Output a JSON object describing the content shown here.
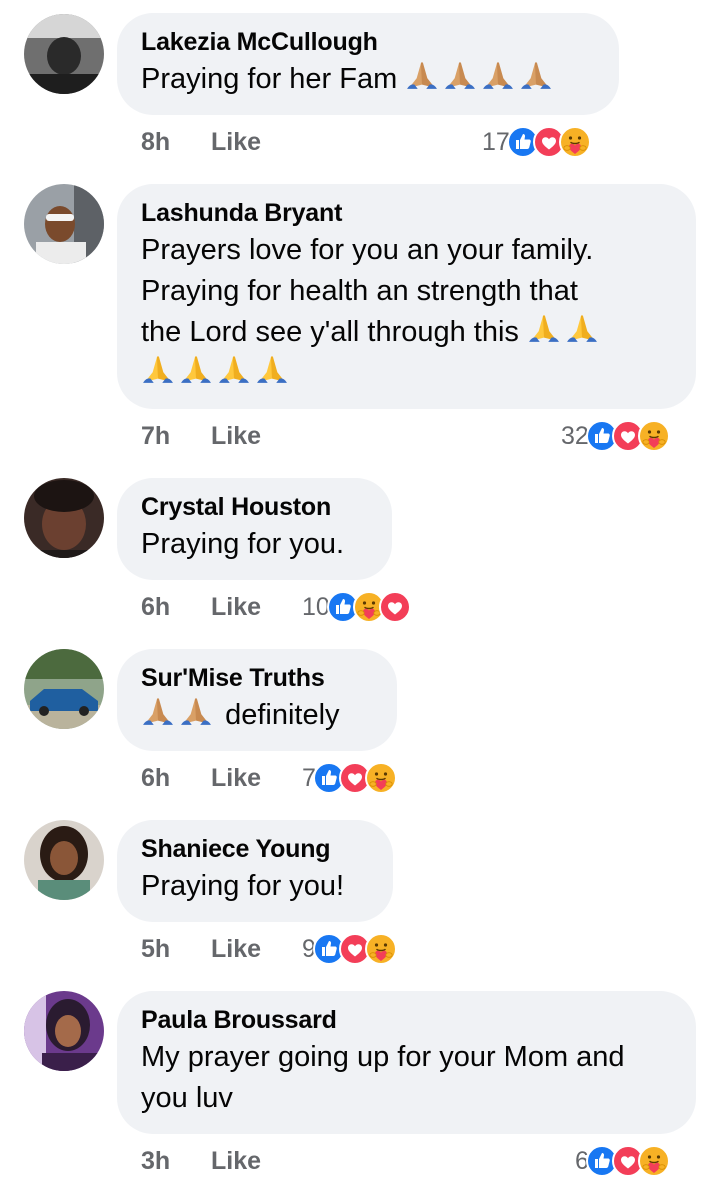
{
  "comments": [
    {
      "author": "Lakezia McCullough",
      "text": "Praying for her Fam",
      "time": "8h",
      "like": "Like",
      "count": "17"
    },
    {
      "author": "Lashunda Bryant",
      "line1": "Prayers love for you an your family.",
      "line2": "Praying for health an strength that",
      "line3": "the Lord see y'all through this",
      "time": "7h",
      "like": "Like",
      "count": "32"
    },
    {
      "author": "Crystal Houston",
      "text": "Praying for you.",
      "time": "6h",
      "like": "Like",
      "count": "10"
    },
    {
      "author": "Sur'Mise Truths",
      "text": "definitely",
      "time": "6h",
      "like": "Like",
      "count": "7"
    },
    {
      "author": "Shaniece Young",
      "text": "Praying for you!",
      "time": "5h",
      "like": "Like",
      "count": "9"
    },
    {
      "author": "Paula Broussard",
      "line1": "My prayer going up for your Mom and",
      "line2": "you luv",
      "time": "3h",
      "like": "Like",
      "count": "6"
    }
  ],
  "reaction_icons": [
    "like-icon",
    "love-icon",
    "care-icon"
  ],
  "colors": {
    "bubble": "#f0f2f5",
    "meta": "#65676b",
    "like_blue": "#1877f2",
    "love_red": "#f33e58",
    "care_yellow": "#f7b125"
  }
}
